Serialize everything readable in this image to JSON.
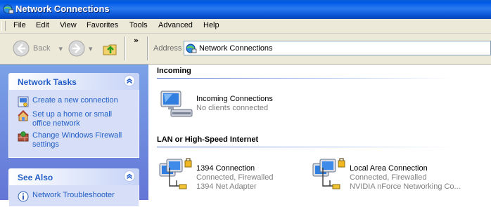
{
  "window": {
    "title": "Network Connections"
  },
  "menu": [
    "File",
    "Edit",
    "View",
    "Favorites",
    "Tools",
    "Advanced",
    "Help"
  ],
  "toolbar": {
    "back_label": "Back",
    "chevrons": "»",
    "address_label": "Address",
    "address_value": "Network Connections"
  },
  "left_panels": {
    "network_tasks": {
      "title": "Network Tasks",
      "items": [
        {
          "icon": "new-connection-icon",
          "label": "Create a new connection"
        },
        {
          "icon": "home-network-icon",
          "label": "Set up a home or small office network"
        },
        {
          "icon": "firewall-icon",
          "label": "Change Windows Firewall settings"
        }
      ]
    },
    "see_also": {
      "title": "See Also",
      "items": [
        {
          "icon": "info-icon",
          "label": "Network Troubleshooter"
        }
      ]
    }
  },
  "groups": [
    {
      "title": "Incoming",
      "items": [
        {
          "name": "Incoming Connections",
          "line2": "No clients connected",
          "line3": ""
        }
      ]
    },
    {
      "title": "LAN or High-Speed Internet",
      "items": [
        {
          "name": "1394 Connection",
          "line2": "Connected, Firewalled",
          "line3": "1394 Net Adapter"
        },
        {
          "name": "Local Area Connection",
          "line2": "Connected, Firewalled",
          "line3": "NVIDIA nForce Networking Co..."
        }
      ]
    }
  ],
  "colors": {
    "title_bar": "#0a5fd8",
    "task_pane": "#6d8fe0",
    "link": "#215dc6"
  }
}
